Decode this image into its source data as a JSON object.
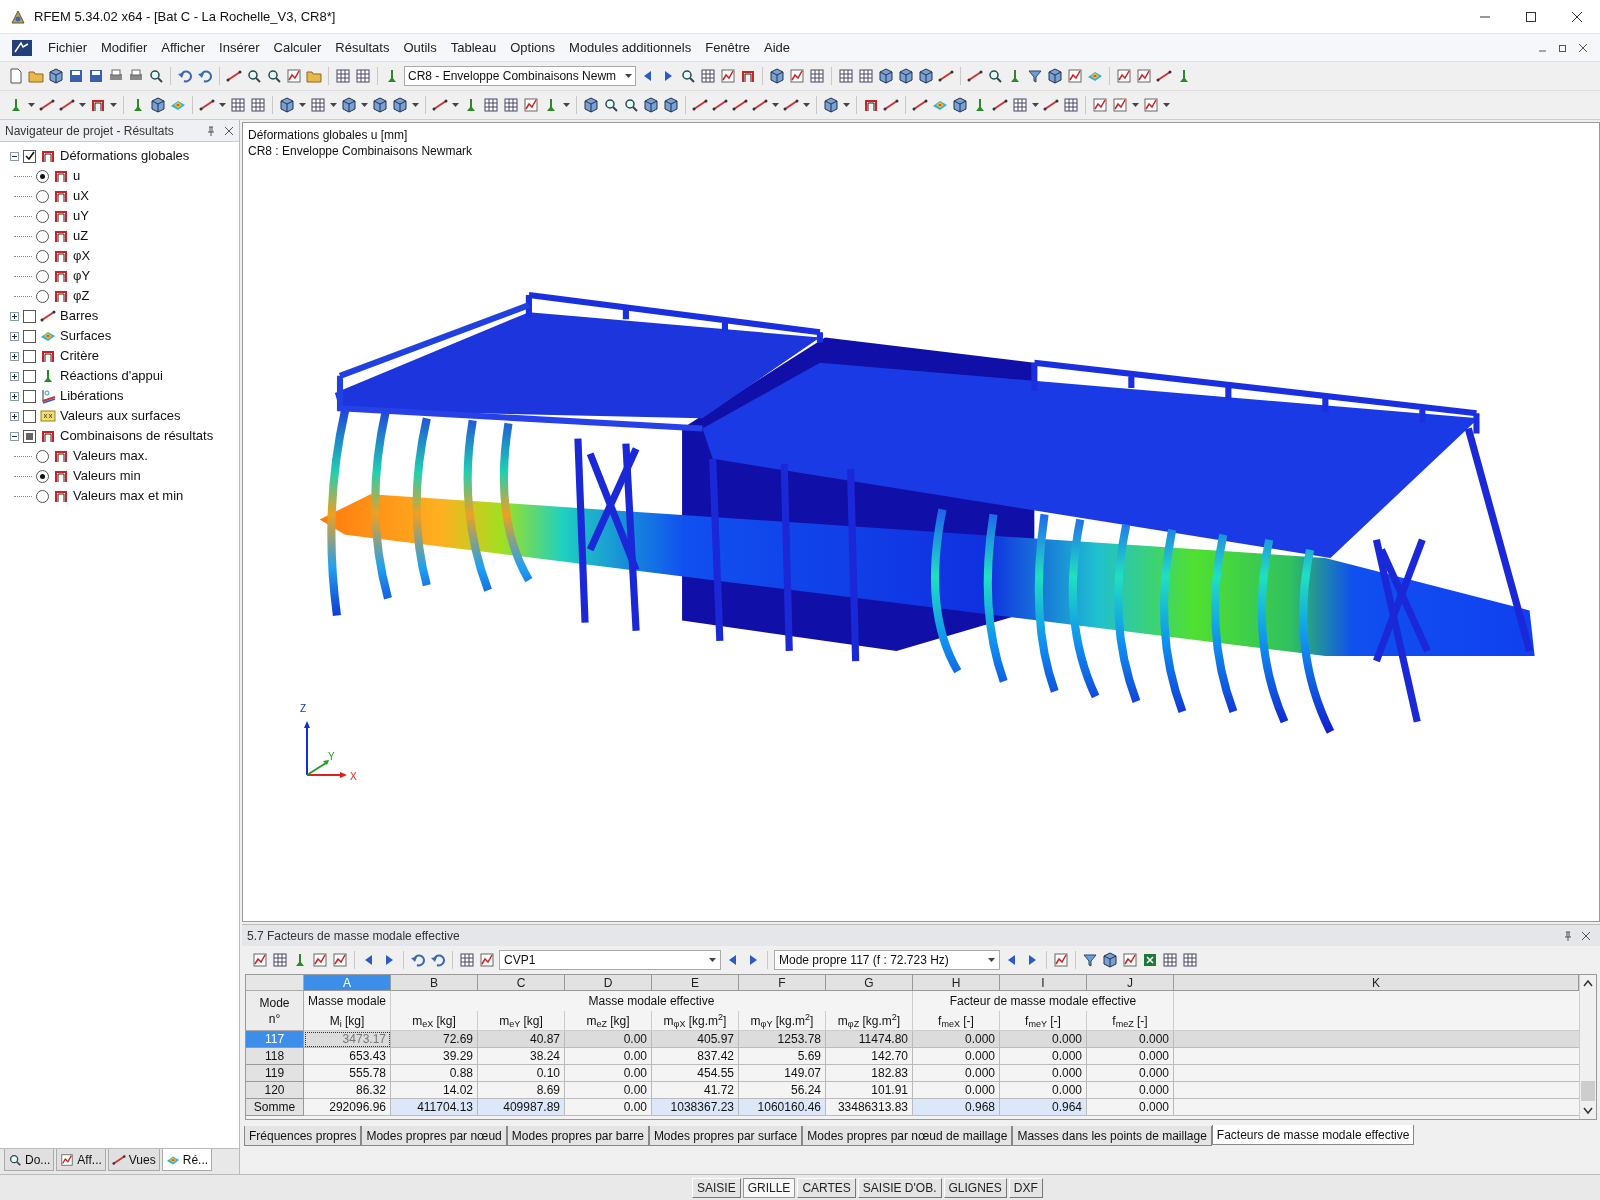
{
  "window": {
    "title": "RFEM 5.34.02 x64 - [Bat C - La Rochelle_V3, CR8*]"
  },
  "menu": [
    "Fichier",
    "Modifier",
    "Afficher",
    "Insérer",
    "Calculer",
    "Résultats",
    "Outils",
    "Tableau",
    "Options",
    "Modules additionnels",
    "Fenêtre",
    "Aide"
  ],
  "toolbar": {
    "load_case": "CR8 - Enveloppe Combinaisons Newm"
  },
  "navigator": {
    "title": "Navigateur de projet - Résultats",
    "tree": [
      {
        "label": "Déformations globales",
        "checked": true,
        "partial": false,
        "expanded": true,
        "children": [
          {
            "label": "u",
            "selected": true
          },
          {
            "label": "uX",
            "selected": false
          },
          {
            "label": "uY",
            "selected": false
          },
          {
            "label": "uZ",
            "selected": false
          },
          {
            "label": "φX",
            "selected": false
          },
          {
            "label": "φY",
            "selected": false
          },
          {
            "label": "φZ",
            "selected": false
          }
        ]
      },
      {
        "label": "Barres",
        "checked": false,
        "partial": false,
        "expanded": false
      },
      {
        "label": "Surfaces",
        "checked": false,
        "partial": false,
        "expanded": false
      },
      {
        "label": "Critère",
        "checked": false,
        "partial": false,
        "expanded": false
      },
      {
        "label": "Réactions d'appui",
        "checked": false,
        "partial": false,
        "expanded": false
      },
      {
        "label": "Libérations",
        "checked": false,
        "partial": false,
        "expanded": false
      },
      {
        "label": "Valeurs aux surfaces",
        "checked": false,
        "partial": false,
        "expanded": false
      },
      {
        "label": "Combinaisons de résultats",
        "checked": false,
        "partial": true,
        "expanded": true,
        "children": [
          {
            "label": "Valeurs max.",
            "selected": false
          },
          {
            "label": "Valeurs min",
            "selected": true
          },
          {
            "label": "Valeurs max et min",
            "selected": false
          }
        ]
      }
    ],
    "tabs": [
      {
        "label": "Do...",
        "selected": false
      },
      {
        "label": "Aff...",
        "selected": false
      },
      {
        "label": "Vues",
        "selected": false
      },
      {
        "label": "Ré...",
        "selected": true
      }
    ]
  },
  "viewport": {
    "title_lines": [
      "Déformations globales u [mm]",
      "CR8 : Enveloppe Combinaisons Newmark"
    ],
    "axes": {
      "z": "Z",
      "y": "Y",
      "x": "X"
    }
  },
  "table_panel": {
    "title": "5.7 Facteurs de masse modale effective",
    "case": "CVP1",
    "mode": "Mode propre 117 (f : 72.723 Hz)",
    "row_header": "Mode n°",
    "column_groups": [
      {
        "label": "Masse modale",
        "columns": [
          {
            "letter": "A",
            "unit": "M$_{i}$ [kg]",
            "selected": true
          }
        ]
      },
      {
        "label": "Masse modale effective",
        "columns": [
          {
            "letter": "B",
            "unit": "m$_{eX}$ [kg]",
            "selected": false
          },
          {
            "letter": "C",
            "unit": "m$_{eY}$ [kg]",
            "selected": false
          },
          {
            "letter": "D",
            "unit": "m$_{eZ}$ [kg]",
            "selected": false
          },
          {
            "letter": "E",
            "unit": "m$_{φX}$ [kg.m$^{2}$]",
            "selected": false
          },
          {
            "letter": "F",
            "unit": "m$_{φY}$ [kg.m$^{2}$]",
            "selected": false
          },
          {
            "letter": "G",
            "unit": "m$_{φZ}$ [kg.m$^{2}$]",
            "selected": false
          }
        ]
      },
      {
        "label": "Facteur de masse modale effective",
        "columns": [
          {
            "letter": "H",
            "unit": "f$_{meX}$ [-]",
            "selected": false
          },
          {
            "letter": "I",
            "unit": "f$_{meY}$ [-]",
            "selected": false
          },
          {
            "letter": "J",
            "unit": "f$_{meZ}$ [-]",
            "selected": false
          }
        ]
      },
      {
        "columns": [
          {
            "letter": "K",
            "selected": false
          }
        ]
      }
    ],
    "rows": [
      {
        "mode": "117",
        "selected": true,
        "cells": [
          {
            "value": "3473.17",
            "highlighted": false
          },
          {
            "value": "72.69",
            "highlighted": false
          },
          {
            "value": "40.87",
            "highlighted": false
          },
          {
            "value": "0.00",
            "highlighted": false
          },
          {
            "value": "405.97",
            "highlighted": false
          },
          {
            "value": "1253.78",
            "highlighted": false
          },
          {
            "value": "11474.80",
            "highlighted": false
          },
          {
            "value": "0.000",
            "highlighted": false
          },
          {
            "value": "0.000",
            "highlighted": false
          },
          {
            "value": "0.000",
            "highlighted": false
          }
        ]
      },
      {
        "mode": "118",
        "selected": false,
        "cells": [
          {
            "value": "653.43",
            "highlighted": false
          },
          {
            "value": "39.29",
            "highlighted": false
          },
          {
            "value": "38.24",
            "highlighted": false
          },
          {
            "value": "0.00",
            "highlighted": false
          },
          {
            "value": "837.42",
            "highlighted": false
          },
          {
            "value": "5.69",
            "highlighted": false
          },
          {
            "value": "142.70",
            "highlighted": false
          },
          {
            "value": "0.000",
            "highlighted": false
          },
          {
            "value": "0.000",
            "highlighted": false
          },
          {
            "value": "0.000",
            "highlighted": false
          }
        ]
      },
      {
        "mode": "119",
        "selected": false,
        "cells": [
          {
            "value": "555.78",
            "highlighted": false
          },
          {
            "value": "0.88",
            "highlighted": false
          },
          {
            "value": "0.10",
            "highlighted": false
          },
          {
            "value": "0.00",
            "highlighted": false
          },
          {
            "value": "454.55",
            "highlighted": false
          },
          {
            "value": "149.07",
            "highlighted": false
          },
          {
            "value": "182.83",
            "highlighted": false
          },
          {
            "value": "0.000",
            "highlighted": false
          },
          {
            "value": "0.000",
            "highlighted": false
          },
          {
            "value": "0.000",
            "highlighted": false
          }
        ]
      },
      {
        "mode": "120",
        "selected": false,
        "cells": [
          {
            "value": "86.32",
            "highlighted": false
          },
          {
            "value": "14.02",
            "highlighted": false
          },
          {
            "value": "8.69",
            "highlighted": false
          },
          {
            "value": "0.00",
            "highlighted": false
          },
          {
            "value": "41.72",
            "highlighted": false
          },
          {
            "value": "56.24",
            "highlighted": false
          },
          {
            "value": "101.91",
            "highlighted": false
          },
          {
            "value": "0.000",
            "highlighted": false
          },
          {
            "value": "0.000",
            "highlighted": false
          },
          {
            "value": "0.000",
            "highlighted": false
          }
        ]
      },
      {
        "mode": "Somme",
        "selected": false,
        "cells": [
          {
            "value": "292096.96",
            "highlighted": false
          },
          {
            "value": "411704.13",
            "highlighted": true
          },
          {
            "value": "409987.89",
            "highlighted": true
          },
          {
            "value": "0.00",
            "highlighted": false
          },
          {
            "value": "1038367.23",
            "highlighted": true
          },
          {
            "value": "1060160.46",
            "highlighted": true
          },
          {
            "value": "33486313.83",
            "highlighted": false
          },
          {
            "value": "0.968",
            "highlighted": true
          },
          {
            "value": "0.964",
            "highlighted": true
          },
          {
            "value": "0.000",
            "highlighted": false
          }
        ]
      }
    ],
    "tabs": [
      {
        "label": "Fréquences propres",
        "selected": false
      },
      {
        "label": "Modes propres par nœud",
        "selected": false
      },
      {
        "label": "Modes propres par barre",
        "selected": false
      },
      {
        "label": "Modes propres par surface",
        "selected": false
      },
      {
        "label": "Modes propres par nœud de maillage",
        "selected": false
      },
      {
        "label": "Masses dans les points de maillage",
        "selected": false
      },
      {
        "label": "Facteurs de masse modale effective",
        "selected": true
      }
    ]
  },
  "status_bar": [
    {
      "label": "SAISIE",
      "on": false
    },
    {
      "label": "GRILLE",
      "on": true
    },
    {
      "label": "CARTES",
      "on": false
    },
    {
      "label": "SAISIE D'OB.",
      "on": false
    },
    {
      "label": "GLIGNES",
      "on": false
    },
    {
      "label": "DXF",
      "on": false
    }
  ]
}
